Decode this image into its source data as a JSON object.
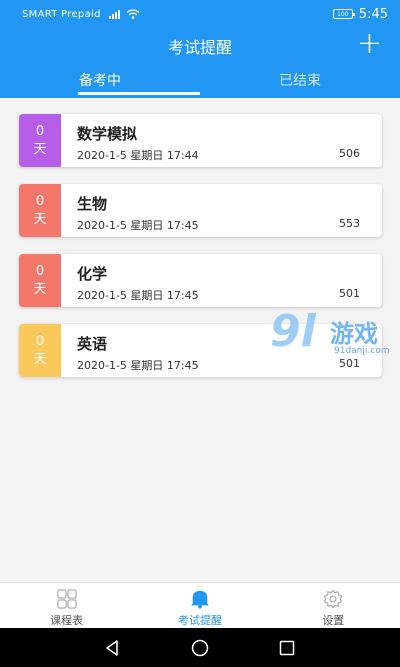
{
  "status": {
    "carrier": "SMART Prepaid",
    "battery": "100",
    "time": "5:45"
  },
  "header": {
    "title": "考试提醒",
    "add_symbol": "+"
  },
  "tabs": [
    {
      "label": "备考中",
      "active": true
    },
    {
      "label": "已结束",
      "active": false
    }
  ],
  "exams": [
    {
      "days": "0",
      "unit": "天",
      "name": "数学模拟",
      "datetime": "2020-1-5 星期日 17:44",
      "number": "506",
      "color": "#b65ee8"
    },
    {
      "days": "0",
      "unit": "天",
      "name": "生物",
      "datetime": "2020-1-5 星期日 17:45",
      "number": "553",
      "color": "#f3776b"
    },
    {
      "days": "0",
      "unit": "天",
      "name": "化学",
      "datetime": "2020-1-5 星期日 17:45",
      "number": "501",
      "color": "#f3776b"
    },
    {
      "days": "0",
      "unit": "天",
      "name": "英语",
      "datetime": "2020-1-5 星期日 17:45",
      "number": "501",
      "color": "#fbc85b"
    }
  ],
  "watermark": {
    "big": "9l",
    "cn": "游戏",
    "url": "91danji.com"
  },
  "bottom_nav": [
    {
      "label": "课程表",
      "icon": "grid-icon",
      "active": false
    },
    {
      "label": "考试提醒",
      "icon": "bell-icon",
      "active": true
    },
    {
      "label": "设置",
      "icon": "gear-icon",
      "active": false
    }
  ],
  "colors": {
    "primary": "#2196f3"
  }
}
